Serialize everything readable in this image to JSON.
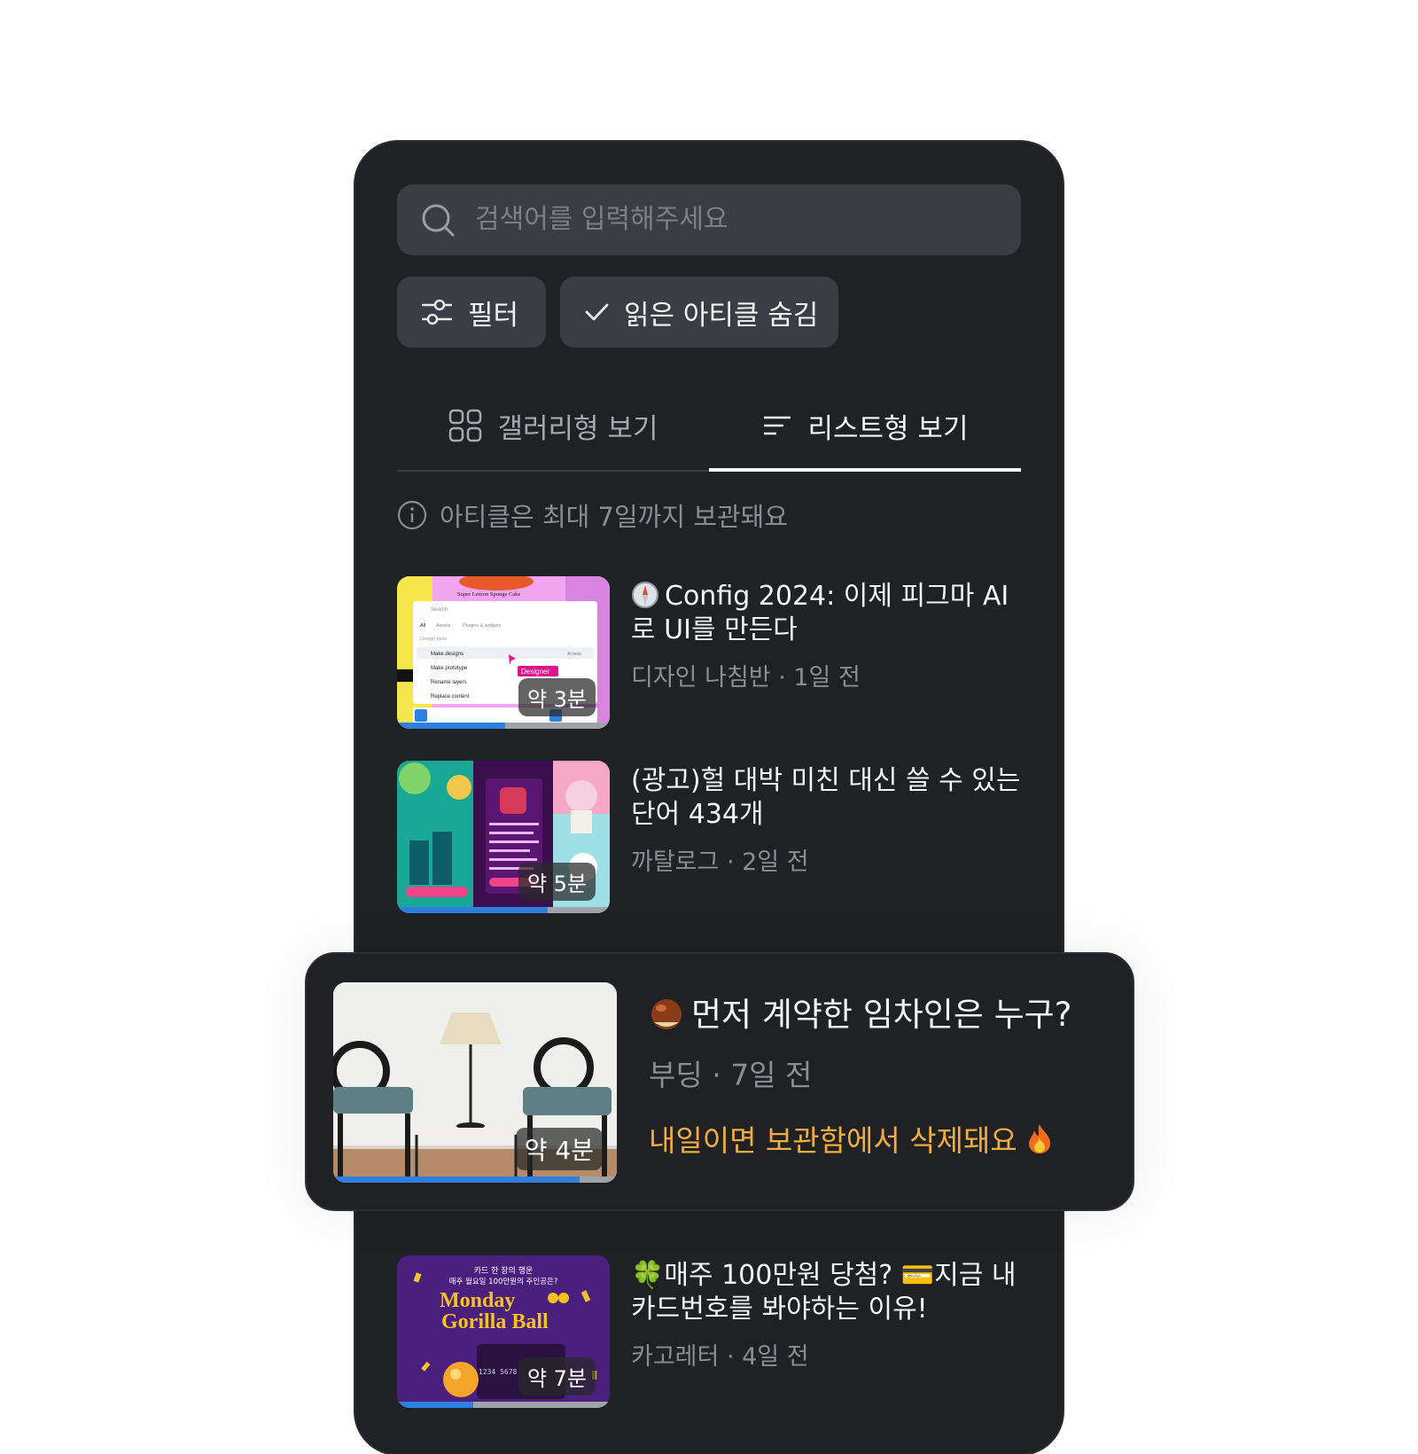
{
  "search": {
    "placeholder": "검색어를 입력해주세요"
  },
  "chips": {
    "filter": "필터",
    "hide_read": "읽은 아티클 숨김"
  },
  "tabs": {
    "gallery": "갤러리형 보기",
    "list": "리스트형 보기",
    "active": "list"
  },
  "notice": "아티클은 최대 7일까지 보관돼요",
  "articles": [
    {
      "title": "Config 2024: 이제 피그마 AI로 UI를 만든다",
      "source": "디자인 나침반 · 1일 전",
      "duration": "약 3분",
      "progress": 0.51,
      "emoji": "compass-icon"
    },
    {
      "title": "(광고)헐 대박 미친 대신 쓸 수 있는 단어 434개",
      "source": "까탈로그 · 2일 전",
      "duration": "약 5분",
      "progress": 0.71
    },
    {
      "title": "먼저 계약한 임차인은 누구?",
      "source": "부딩 · 7일 전",
      "duration": "약 4분",
      "progress": 0.87,
      "warning": "내일이면 보관함에서 삭제돼요",
      "emoji": "chestnut-icon"
    },
    {
      "title": "🍀매주 100만원 당첨? 💳지금 내 카드번호를 봐야하는 이유!",
      "source": "카고레터 · 4일 전",
      "duration": "약 7분",
      "progress": 0.36
    }
  ],
  "thumb_texts": {
    "config_menu": [
      "Super Lemon Sponge Cake",
      "Search",
      "All",
      "Assets",
      "Plugins & widgets",
      "Design tools",
      "Make designs",
      "AI beta",
      "Make prototype",
      "Rename layers",
      "Replace content",
      "Designer"
    ],
    "gorilla": [
      "카드 한 장의 행운",
      "매주 월요일 100만원의 주인공은?",
      "Monday",
      "Gorilla Ball",
      "1234 5678"
    ]
  },
  "colors": {
    "background": "#202124",
    "surface": "#3a3e44",
    "accent_progress": "#2f7fe0",
    "warning": "#f4ad3d"
  }
}
